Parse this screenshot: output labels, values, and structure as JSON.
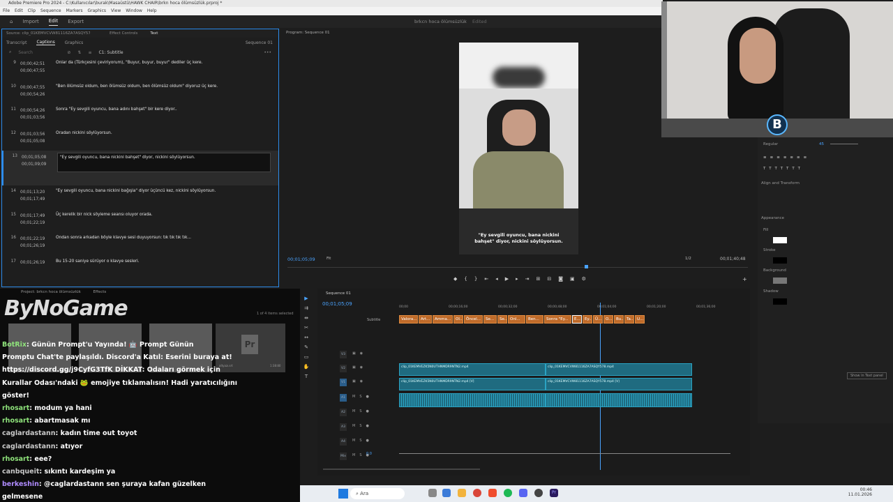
{
  "window": {
    "title": "Adobe Premiere Pro 2024 - C:\\Kullanıcılar\\burak\\Masaüstü\\HAWK CHAIR\\brkn hoca ölümsüzlük.prproj *"
  },
  "menu": [
    "File",
    "Edit",
    "Clip",
    "Sequence",
    "Markers",
    "Graphics",
    "View",
    "Window",
    "Help"
  ],
  "workspace": {
    "tabs": [
      "Import",
      "Edit",
      "Export"
    ],
    "active": "Edit",
    "doc_title": "brkcn hoca ölümsüzlük",
    "doc_status": "Edited"
  },
  "source_panel": {
    "tabs": [
      "Source: clip_01KEMVCVW81116ZA7ASQY578.mp4",
      "Effect Controls",
      "Text"
    ],
    "sequence": "Sequence 01"
  },
  "text_panel": {
    "subtabs": [
      "Transcript",
      "Captions",
      "Graphics"
    ],
    "active": "Captions",
    "search_placeholder": "Search",
    "track": "C1: Subtitle",
    "captions": [
      {
        "num": "9",
        "in": "00;00;42;51",
        "out": "00;00;47;55",
        "text": "Onlar da (Türkçesini çeviriyorum), \"Buyur, buyur, buyur\" dediler üç kere."
      },
      {
        "num": "10",
        "in": "00;00;47;55",
        "out": "00;00;54;26",
        "text": "\"Ben ölümsüz oldum, ben ölümsüz oldum, ben ölümsüz oldum\" diyoruz üç kere."
      },
      {
        "num": "11",
        "in": "00;00;54;26",
        "out": "00;01;03;56",
        "text": "Sonra \"Ey sevgili oyuncu, bana adını bahşet\" bir kere diyor.."
      },
      {
        "num": "12",
        "in": "00;01;03;56",
        "out": "00;01;05;08",
        "text": "Oradan nickini söylüyorsun."
      },
      {
        "num": "13",
        "in": "00;01;05;08",
        "out": "00;01;09;09",
        "text": "\"Ey sevgili oyuncu, bana nickini bahşet\" diyor, nickini söylüyorsun."
      },
      {
        "num": "14",
        "in": "00;01;13;20",
        "out": "00;01;17;49",
        "text": "\"Ey sevgili oyuncu, bana nickini bağışla\" diyor üçüncü kez, nickini söylüyorsun."
      },
      {
        "num": "15",
        "in": "00;01;17;49",
        "out": "00;01;22;19",
        "text": "Üç kerelik bir nick söyleme seansı oluyor orada."
      },
      {
        "num": "16",
        "in": "00;01;22;19",
        "out": "00;01;26;19",
        "text": "Ondan sonra arkadan böyle klavye sesi duyuyorsun: tık tık tık tık..."
      },
      {
        "num": "17",
        "in": "00;01;26;19",
        "out": "",
        "text": "Bu 15-20 saniye sürüyor o klavye sesleri."
      }
    ],
    "selected_index": 4
  },
  "program_monitor": {
    "title": "Program: Sequence 01",
    "timecode": "00;01;05;09",
    "fit": "Fit",
    "page": "1/2",
    "duration": "00;01;40;48",
    "subtitle_line1": "\"Ey sevgili oyuncu, bana nickini",
    "subtitle_line2": "bahşet\" diyor, nickini söylüyorsun."
  },
  "essential_graphics": {
    "font_style": "Regular",
    "size": "45",
    "section_align": "Align and Transform",
    "section_appearance": "Appearance",
    "fill": "Fill",
    "stroke": "Stroke",
    "background": "Background",
    "shadow": "Shadow",
    "show_btn": "Show in Text panel"
  },
  "project_panel": {
    "title": "Project: brkcn hoca ölümsüzlük",
    "effects": "Effects",
    "items_info": "1 of 4 items selected",
    "thumb_name": "altyazı.srt",
    "thumb_dur": "1:38:80"
  },
  "overlay": {
    "brand": "ByNoGame"
  },
  "chat": [
    {
      "user": "BotRix",
      "msg": ": Günün Prompt'u Yayında! 🤖 Prompt Günün"
    },
    {
      "user": "",
      "msg": "Promptu Chat'te paylaşıldı. Discord'a Katıl: Eserini buraya at!"
    },
    {
      "user": "",
      "msg": "https://discord.gg/j9CyfG3TfK DİKKAT: Odaları görmek için"
    },
    {
      "user": "",
      "msg": "Kurallar Odası'ndaki 🐸 emojiye tıklamalısın! Hadi yaratıcılığını"
    },
    {
      "user": "",
      "msg": "göster!"
    },
    {
      "user": "rhosart",
      "msg": ": modum ya hani"
    },
    {
      "user": "rhosart",
      "msg": ": abartmasak mı"
    },
    {
      "user": "caglardastann",
      "msg": ": kadın time out toyot"
    },
    {
      "user": "caglardastann",
      "msg": ": atıyor"
    },
    {
      "user": "rhosart",
      "msg": ": eee?"
    },
    {
      "user": "canbqueit",
      "msg": ": sıkıntı kardeşim ya"
    },
    {
      "user": "berkeshin",
      "msg": ": @caglardastann sen şuraya kafan güzelken"
    },
    {
      "user": "",
      "msg": "gelmesene"
    }
  ],
  "timeline": {
    "sequence": "Sequence 01",
    "timecode": "00;01;05;09",
    "ruler": [
      "00;00",
      "00;00;16;00",
      "00;00;32;00",
      "00;00;48;00",
      "00;01;04;00",
      "00;01;20;00",
      "00;01;36;00"
    ],
    "subtitle_track": "Subtitle",
    "subclips": [
      "Valora...",
      "Art...",
      "Amma...",
      "Ol...",
      "Öncel...",
      "Se...",
      "Se...",
      "Onl...",
      "Ben...",
      "Sonra \"Ey...",
      "E...",
      "Ey...",
      "Ü...",
      "O...",
      "Bu...",
      "Ta...",
      "U..."
    ],
    "video_clips": [
      "clip_01KEMVEZK5N0UTHNMDR9NTN2.mp4",
      "clip_01KEMVCVW81116ZA7ASQY578.mp4"
    ],
    "audio_clips": [
      "clip_01KEMVEZK5N0UTHNMDR9NTN2.mp4 [V]",
      "clip_01KEMVCVW81116ZA7ASQY578.mp4 [V]"
    ],
    "tracks": [
      "V3",
      "V2",
      "V1",
      "A1",
      "A2",
      "A3",
      "A4",
      "Mix"
    ],
    "mix_value": "0.0"
  },
  "taskbar": {
    "search": "Ara",
    "time": "00:46",
    "date": "11.01.2026"
  }
}
